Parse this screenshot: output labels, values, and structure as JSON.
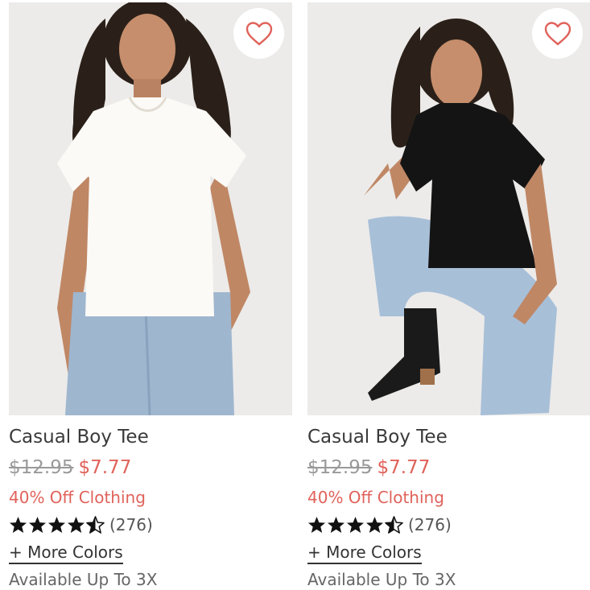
{
  "colors": {
    "accent": "#e0625a",
    "heart": "#e0625a",
    "strike": "#9a9a9a"
  },
  "products": [
    {
      "image_alt": "Woman wearing white tee and light jeans",
      "favorite_icon": "heart-outline-icon",
      "name": "Casual Boy Tee",
      "original_price": "$12.95",
      "sale_price": "$7.77",
      "promo": "40% Off Clothing",
      "rating": 4.5,
      "review_count": "(276)",
      "more_colors": "+ More Colors",
      "availability": "Available Up To 3X"
    },
    {
      "image_alt": "Woman wearing black tee, light jeans and black boots",
      "favorite_icon": "heart-outline-icon",
      "name": "Casual Boy Tee",
      "original_price": "$12.95",
      "sale_price": "$7.77",
      "promo": "40% Off Clothing",
      "rating": 4.5,
      "review_count": "(276)",
      "more_colors": "+ More Colors",
      "availability": "Available Up To 3X"
    }
  ]
}
